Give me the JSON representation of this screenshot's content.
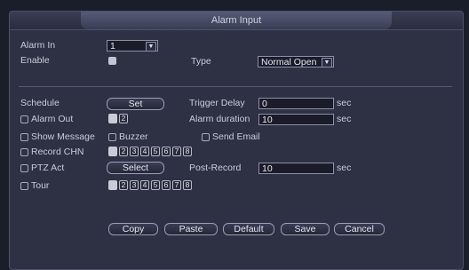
{
  "window": {
    "title": "Alarm Input"
  },
  "alarm_in": {
    "label": "Alarm In",
    "value": "1"
  },
  "enable": {
    "label": "Enable",
    "checked": true
  },
  "type": {
    "label": "Type",
    "value": "Normal Open"
  },
  "schedule": {
    "label": "Schedule",
    "button": "Set"
  },
  "trigger_delay": {
    "label": "Trigger Delay",
    "value": "0",
    "unit": "sec"
  },
  "alarm_out": {
    "label": "Alarm Out",
    "channels": [
      "1",
      "2"
    ]
  },
  "alarm_duration": {
    "label": "Alarm duration",
    "value": "10",
    "unit": "sec"
  },
  "show_message": {
    "label": "Show Message"
  },
  "buzzer": {
    "label": "Buzzer"
  },
  "send_email": {
    "label": "Send Email"
  },
  "record_chn": {
    "label": "Record CHN",
    "channels": [
      "1",
      "2",
      "3",
      "4",
      "5",
      "6",
      "7",
      "8"
    ]
  },
  "ptz_act": {
    "label": "PTZ Act",
    "button": "Select"
  },
  "post_record": {
    "label": "Post-Record",
    "value": "10",
    "unit": "sec"
  },
  "tour": {
    "label": "Tour",
    "channels": [
      "1",
      "2",
      "3",
      "4",
      "5",
      "6",
      "7",
      "8"
    ]
  },
  "footer": {
    "copy": "Copy",
    "paste": "Paste",
    "default": "Default",
    "save": "Save",
    "cancel": "Cancel"
  }
}
